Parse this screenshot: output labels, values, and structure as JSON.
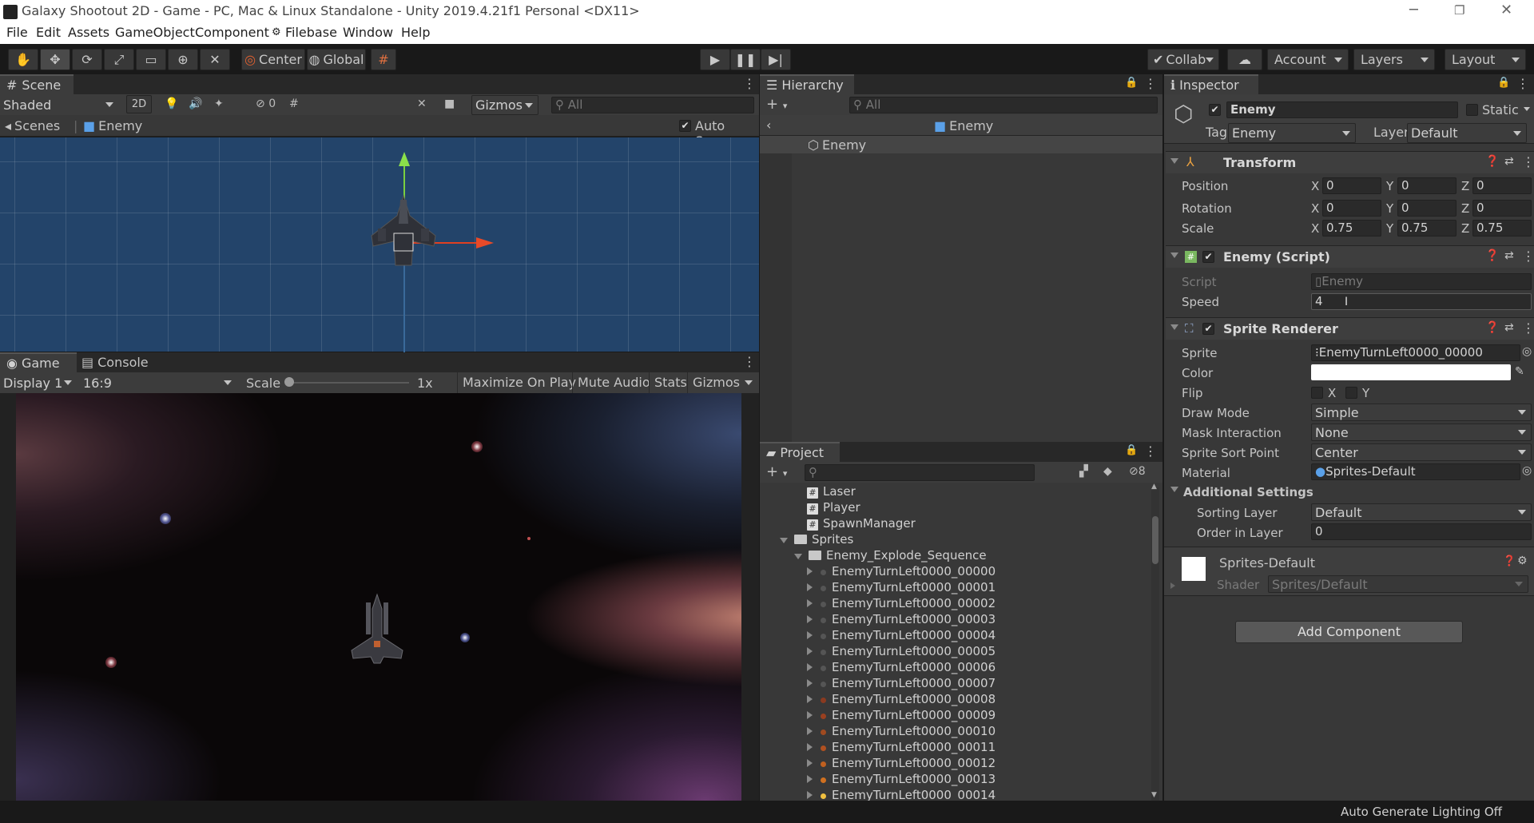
{
  "window": {
    "title": "Galaxy Shootout 2D - Game - PC, Mac & Linux Standalone - Unity 2019.4.21f1 Personal <DX11>"
  },
  "menu": [
    "File",
    "Edit",
    "Assets",
    "GameObject",
    "Component",
    "Filebase",
    "Window",
    "Help"
  ],
  "toolbar": {
    "center": "Center",
    "global": "Global",
    "collab": "Collab",
    "account": "Account",
    "layers": "Layers",
    "layout": "Layout"
  },
  "scene": {
    "tab": "Scene",
    "shading": "Shaded",
    "mode2d": "2D",
    "hidden_count": "0",
    "gizmos": "Gizmos",
    "search_placeholder": "All",
    "breadcrumb_root": "Scenes",
    "breadcrumb_object": "Enemy",
    "auto_save": "Auto Save"
  },
  "game": {
    "tab": "Game",
    "console_tab": "Console",
    "display": "Display 1",
    "aspect": "16:9",
    "scale_label": "Scale",
    "scale_value": "1x",
    "maximize": "Maximize On Play",
    "mute": "Mute Audio",
    "stats": "Stats",
    "gizmos": "Gizmos"
  },
  "hierarchy": {
    "tab": "Hierarchy",
    "search_placeholder": "All",
    "root": "Enemy",
    "child": "Enemy"
  },
  "project": {
    "tab": "Project",
    "hidden_count": "8",
    "scripts": [
      "Laser",
      "Player",
      "SpawnManager"
    ],
    "folder_sprites": "Sprites",
    "folder_explode": "Enemy_Explode_Sequence",
    "sprites": [
      "EnemyTurnLeft0000_00000",
      "EnemyTurnLeft0000_00001",
      "EnemyTurnLeft0000_00002",
      "EnemyTurnLeft0000_00003",
      "EnemyTurnLeft0000_00004",
      "EnemyTurnLeft0000_00005",
      "EnemyTurnLeft0000_00006",
      "EnemyTurnLeft0000_00007",
      "EnemyTurnLeft0000_00008",
      "EnemyTurnLeft0000_00009",
      "EnemyTurnLeft0000_00010",
      "EnemyTurnLeft0000_00011",
      "EnemyTurnLeft0000_00012",
      "EnemyTurnLeft0000_00013",
      "EnemyTurnLeft0000_00014"
    ]
  },
  "inspector": {
    "tab": "Inspector",
    "name": "Enemy",
    "static": "Static",
    "tag_label": "Tag",
    "tag": "Enemy",
    "layer_label": "Layer",
    "layer": "Default",
    "transform": {
      "title": "Transform",
      "position_label": "Position",
      "rotation_label": "Rotation",
      "scale_label": "Scale",
      "position": {
        "x": "0",
        "y": "0",
        "z": "0"
      },
      "rotation": {
        "x": "0",
        "y": "0",
        "z": "0"
      },
      "scale": {
        "x": "0.75",
        "y": "0.75",
        "z": "0.75"
      }
    },
    "enemy_script": {
      "title": "Enemy (Script)",
      "script_label": "Script",
      "script": "Enemy",
      "speed_label": "Speed",
      "speed": "4"
    },
    "sprite_renderer": {
      "title": "Sprite Renderer",
      "sprite_label": "Sprite",
      "sprite": "EnemyTurnLeft0000_00000",
      "color_label": "Color",
      "color": "#ffffff",
      "flip_label": "Flip",
      "flip_x": "X",
      "flip_y": "Y",
      "draw_mode_label": "Draw Mode",
      "draw_mode": "Simple",
      "mask_label": "Mask Interaction",
      "mask": "None",
      "sort_point_label": "Sprite Sort Point",
      "sort_point": "Center",
      "material_label": "Material",
      "material": "Sprites-Default",
      "additional": "Additional Settings",
      "sorting_layer_label": "Sorting Layer",
      "sorting_layer": "Default",
      "order_label": "Order in Layer",
      "order": "0"
    },
    "material": {
      "name": "Sprites-Default",
      "shader_label": "Shader",
      "shader": "Sprites/Default"
    },
    "add_component": "Add Component"
  },
  "statusbar": {
    "text": "Auto Generate Lighting Off"
  }
}
